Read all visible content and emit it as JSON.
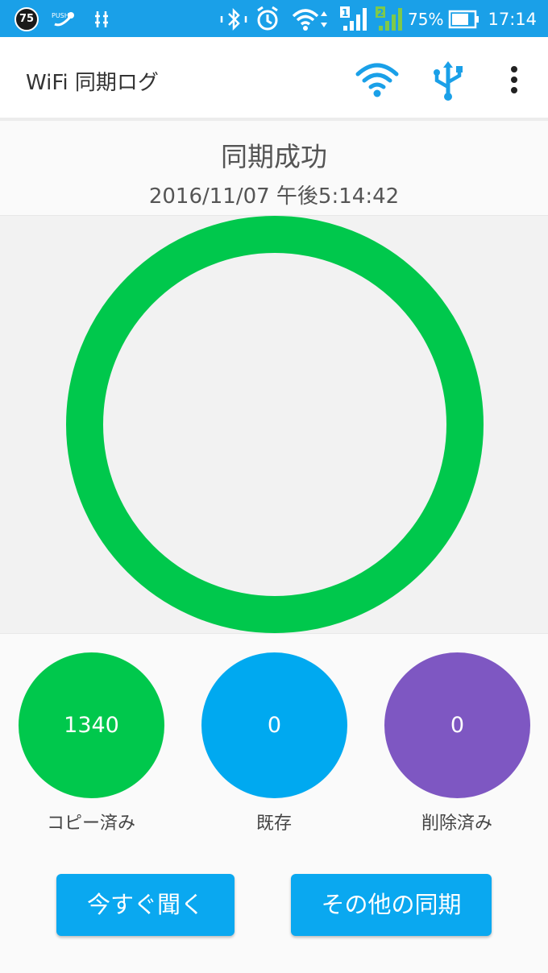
{
  "status_bar": {
    "badge": "75",
    "battery_percent": "75%",
    "time": "17:14",
    "sim1": "1",
    "sim2": "2",
    "icons": [
      "notification-badge-icon",
      "fusion-icon",
      "usb-debug-icon",
      "bluetooth-icon",
      "alarm-icon",
      "wifi-icon",
      "signal-sim1-icon",
      "signal-sim2-icon",
      "battery-icon"
    ]
  },
  "app_bar": {
    "title": "WiFi 同期ログ",
    "actions": [
      "wifi-icon",
      "usb-icon",
      "more-vert-icon"
    ],
    "accent": "#1aa0e8"
  },
  "sync": {
    "status": "同期成功",
    "datetime": "2016/11/07 午後5:14:42",
    "ring_color": "#00c84c"
  },
  "stats": [
    {
      "value": "1340",
      "label": "コピー済み",
      "color": "#00c84c"
    },
    {
      "value": "0",
      "label": "既存",
      "color": "#00a9f0"
    },
    {
      "value": "0",
      "label": "削除済み",
      "color": "#7e57c2"
    }
  ],
  "buttons": {
    "listen_now": "今すぐ聞く",
    "other_sync": "その他の同期"
  }
}
